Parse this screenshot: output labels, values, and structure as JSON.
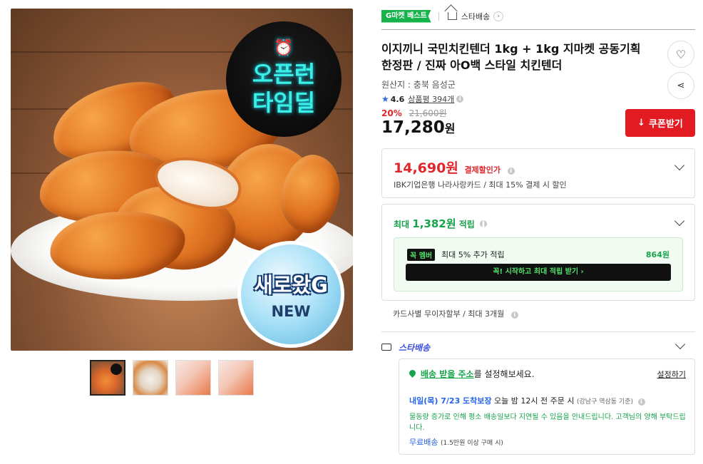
{
  "gallery": {
    "badge_time": [
      "오픈런",
      "타임딜"
    ],
    "badge_new": [
      "새로왔G",
      "NEW"
    ],
    "thumbnail_count": 4
  },
  "breadcrumb": {
    "g_badge": "G마켓 베스트",
    "store": "스타배송"
  },
  "product": {
    "title": "이지끼니 국민치킨텐더 1kg + 1kg 지마켓 공동기획 한정판 / 진짜 아O백 스타일 치킨텐더",
    "origin": "원산지 : 충북 음성군",
    "rating": "4.6",
    "review_label": "상품평",
    "review_count": "394개",
    "discount_rate": "20%",
    "original_price": "21,600원",
    "price_value": "17,280",
    "price_unit": "원",
    "coupon_label": "쿠폰받기"
  },
  "card_discount": {
    "price": "14,690원",
    "label": "결제할인가",
    "desc": "IBK기업은행 나라사랑카드 / 최대 15% 결제 시 할인"
  },
  "points": {
    "prefix": "최대",
    "amount": "1,382원",
    "suffix": "적립",
    "member_tag": "멤버",
    "member_text": "최대 5% 추가 적립",
    "member_points": "864원",
    "member_button": "꼭! 시작하고 최대 적립 받기 ›"
  },
  "installment": "카드사별 무이자할부 / 최대 3개월",
  "shipping": {
    "logo": "스타배송",
    "address_link": "배송 받을 주소",
    "address_rest": "를 설정해보세요.",
    "set_button": "설정하기",
    "eta_date": "내일(목) 7/23 도착보장",
    "eta_rest": "오늘 밤 12시 전 주문 시",
    "eta_note": "(강남구 역삼동 기준)",
    "notice": "물동량 증가로 인해 평소 배송일보다 지연될 수 있음을 안내드립니다. 고객님의 양해 부탁드립니다.",
    "free_label": "무료배송",
    "free_condition": "(1.5만원 이상 구매 시)"
  },
  "colors": {
    "accent_red": "#e21b22",
    "green": "#16a34a",
    "blue": "#2563eb"
  }
}
